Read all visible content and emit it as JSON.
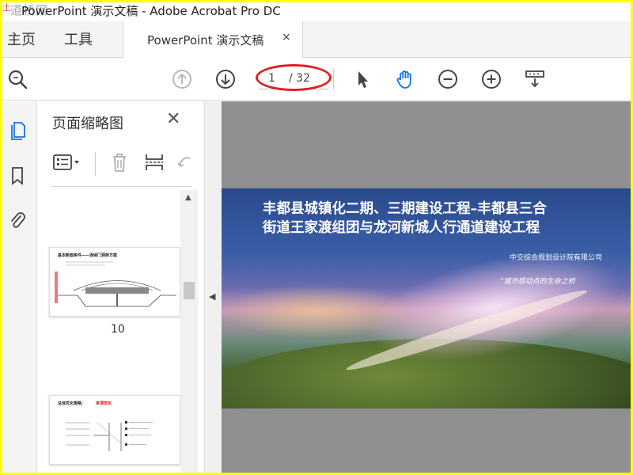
{
  "window": {
    "title": "PowerPoint 演示文稿 - Adobe Acrobat Pro DC",
    "watermark": "道桥网",
    "watermark_mark": "土"
  },
  "tabs": {
    "home": "主页",
    "tools": "工具",
    "document": "PowerPoint 演示文稿",
    "close_glyph": "×"
  },
  "toolbar": {
    "current_page": "1",
    "page_total": "/ 32",
    "icons": [
      "search-icon",
      "page-up-icon",
      "page-down-icon",
      "select-arrow-icon",
      "hand-tool-icon",
      "zoom-out-icon",
      "zoom-in-icon",
      "scroll-mode-icon"
    ],
    "hand_color": "#1473e6",
    "annotation_color": "#e02020"
  },
  "sidebar": {
    "icons": [
      "page-thumbnails-icon",
      "bookmark-icon",
      "attachment-icon"
    ],
    "accent": "#1473e6"
  },
  "thumbnail_panel": {
    "title": "页面缩略图",
    "close_glyph": "✕",
    "tools": [
      "thumbnail-options-icon",
      "delete-page-icon",
      "insert-page-icon",
      "rotate-page-icon"
    ],
    "pages": [
      {
        "number": "10",
        "heading": "基本断面条件——连续门洞桥方案"
      },
      {
        "number": "",
        "heading": "总体优化策略：",
        "heading_red": "多项优化"
      }
    ]
  },
  "slide": {
    "title_line1": "丰都县城镇化二期、三期建设工程–丰都县三合",
    "title_line2": "街道王家渡组团与龙河新城人行通道建设工程",
    "company": "中交综合规划设计院有限公司",
    "slogan": "“城市感动点的生命之桥"
  }
}
